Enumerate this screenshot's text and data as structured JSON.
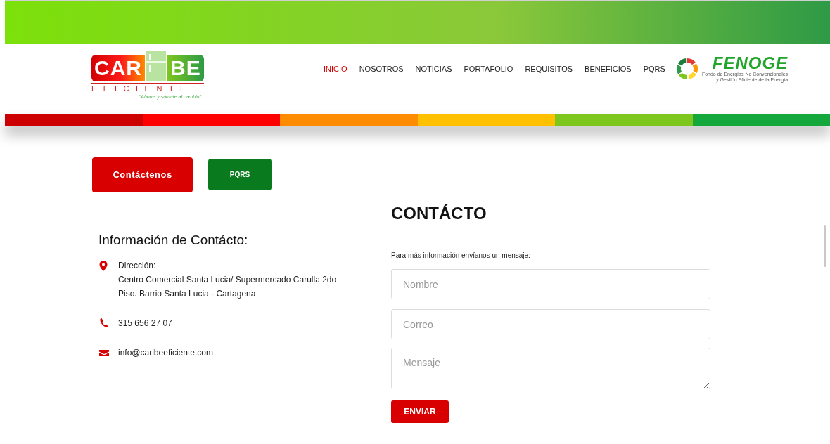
{
  "logo": {
    "word_1": "CAR",
    "word_2": "BE",
    "subtitle": "EFICIENTE",
    "tagline": "\"Ahorra y súmate al cambio\""
  },
  "nav": [
    {
      "label": "INICIO",
      "selected": true
    },
    {
      "label": "NOSOTROS",
      "selected": false
    },
    {
      "label": "NOTICIAS",
      "selected": false
    },
    {
      "label": "PORTAFOLIO",
      "selected": false
    },
    {
      "label": "REQUISITOS",
      "selected": false
    },
    {
      "label": "BENEFICIOS",
      "selected": false
    },
    {
      "label": "PQRS",
      "selected": false
    }
  ],
  "partner_logo": {
    "name": "FENOGE",
    "line_1": "Fondo de Energías No Convencionales",
    "line_2": "y Gestión Eficiente de la Energía"
  },
  "stripe": [
    {
      "color": "#cc0000"
    },
    {
      "color": "#ff0000"
    },
    {
      "color": "#ff8c00"
    },
    {
      "color": "#ffc000"
    },
    {
      "color": "#7cc61e"
    },
    {
      "color": "#14a83c"
    }
  ],
  "tab_buttons": [
    {
      "label": "Contáctenos",
      "selected": true
    },
    {
      "label": "PQRS",
      "selected": false
    }
  ],
  "contact_info": {
    "title": "Información de Contácto:",
    "items": [
      {
        "kind": "address",
        "lines": [
          "Dirección:",
          "Centro Comercial Santa Lucia/ Supermercado Carulla 2do Piso. Barrio Santa Lucia - Cartagena"
        ]
      },
      {
        "kind": "phone",
        "lines": [
          "315 656 27 07"
        ]
      },
      {
        "kind": "email",
        "lines": [
          "info@caribeeficiente.com"
        ]
      }
    ]
  },
  "form": {
    "title": "CONTÁCTO",
    "intro": "Para más información envíanos un mensaje:",
    "fields": [
      {
        "kind": "input",
        "placeholder": "Nombre"
      },
      {
        "kind": "input",
        "placeholder": "Correo"
      },
      {
        "kind": "textarea",
        "placeholder": "Mensaje"
      }
    ],
    "submit": "ENVIAR"
  }
}
